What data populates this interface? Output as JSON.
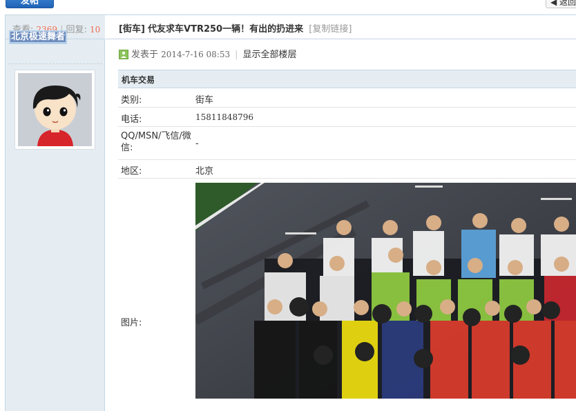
{
  "toolbar": {
    "post_label": "发帖",
    "back_label": "◀ 返回"
  },
  "stats": {
    "views_label": "查看:",
    "views": "2369",
    "replies_label": "回复:",
    "replies": "10"
  },
  "author": {
    "name": "北京极速舞者"
  },
  "thread": {
    "category": "[街车]",
    "title": "代友求车VTR250一辆！有出的扔进来",
    "copy_link": "[复制链接]"
  },
  "post_meta": {
    "posted_prefix": "发表于",
    "datetime": "2014-7-16 08:53",
    "show_all": "显示全部楼层"
  },
  "listing": {
    "section_title": "机车交易",
    "rows": [
      {
        "key": "类别:",
        "value": "街车"
      },
      {
        "key": "电话:",
        "value": "15811848796"
      },
      {
        "key": "QQ/MSN/飞信/微信:",
        "value": "-"
      },
      {
        "key": "地区:",
        "value": "北京"
      },
      {
        "key": "图片:",
        "value": ""
      }
    ]
  },
  "colors": {
    "side_bg": "#e5edf2",
    "border": "#c2d5e3",
    "stat_number": "#f26c4f",
    "author_highlight": "#6d8cbd"
  }
}
